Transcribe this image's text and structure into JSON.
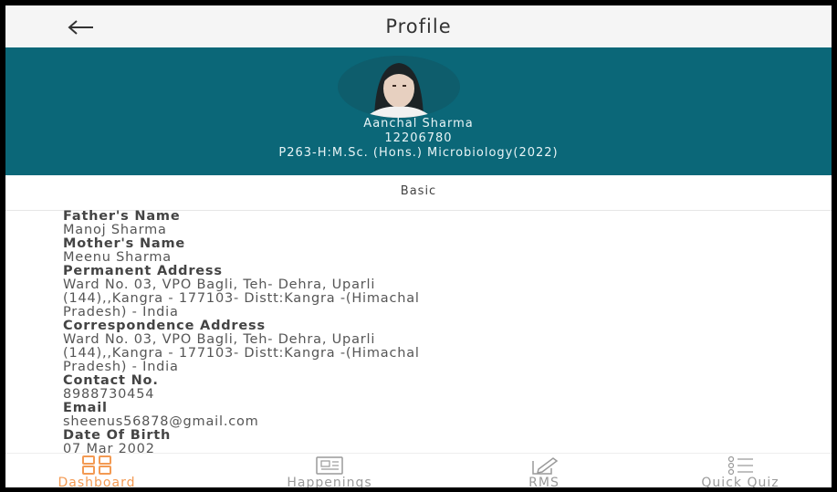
{
  "topbar": {
    "back_icon": "arrow-left-icon",
    "title": "Profile"
  },
  "header": {
    "name": "Aanchal Sharma",
    "registration_no": "12206780",
    "program": "P263-H:M.Sc. (Hons.) Microbiology(2022)",
    "color": "#0b6778"
  },
  "tabs": {
    "basic": "Basic"
  },
  "details": {
    "father_label": "Father's Name",
    "father_value": "Manoj Sharma",
    "mother_label": "Mother's Name",
    "mother_value": "Meenu Sharma",
    "permanent_label": "Permanent Address",
    "permanent_line1": "Ward No. 03, VPO Bagli, Teh- Dehra, Uparli",
    "permanent_line2": "(144),,Kangra - 177103- Distt:Kangra -(Himachal",
    "permanent_line3": "Pradesh) - India",
    "correspondence_label": "Correspondence Address",
    "correspondence_line1": "Ward No. 03, VPO Bagli, Teh- Dehra, Uparli",
    "correspondence_line2": "(144),,Kangra - 177103- Distt:Kangra -(Himachal",
    "correspondence_line3": "Pradesh) - India",
    "contact_label": "Contact No.",
    "contact_value": "8988730454",
    "email_label": "Email",
    "email_value": "sheenus56878@gmail.com",
    "dob_label": "Date Of Birth",
    "dob_value": "07 Mar 2002"
  },
  "bottom_nav": {
    "items": [
      {
        "label": "Dashboard",
        "icon": "grid-icon",
        "active": true
      },
      {
        "label": "Happenings",
        "icon": "newspaper-icon",
        "active": false
      },
      {
        "label": "RMS",
        "icon": "edit-icon",
        "active": false
      },
      {
        "label": "Quick Quiz",
        "icon": "list-icon",
        "active": false
      }
    ],
    "active_color": "#f39a53",
    "inactive_color": "#9a9a9a"
  }
}
